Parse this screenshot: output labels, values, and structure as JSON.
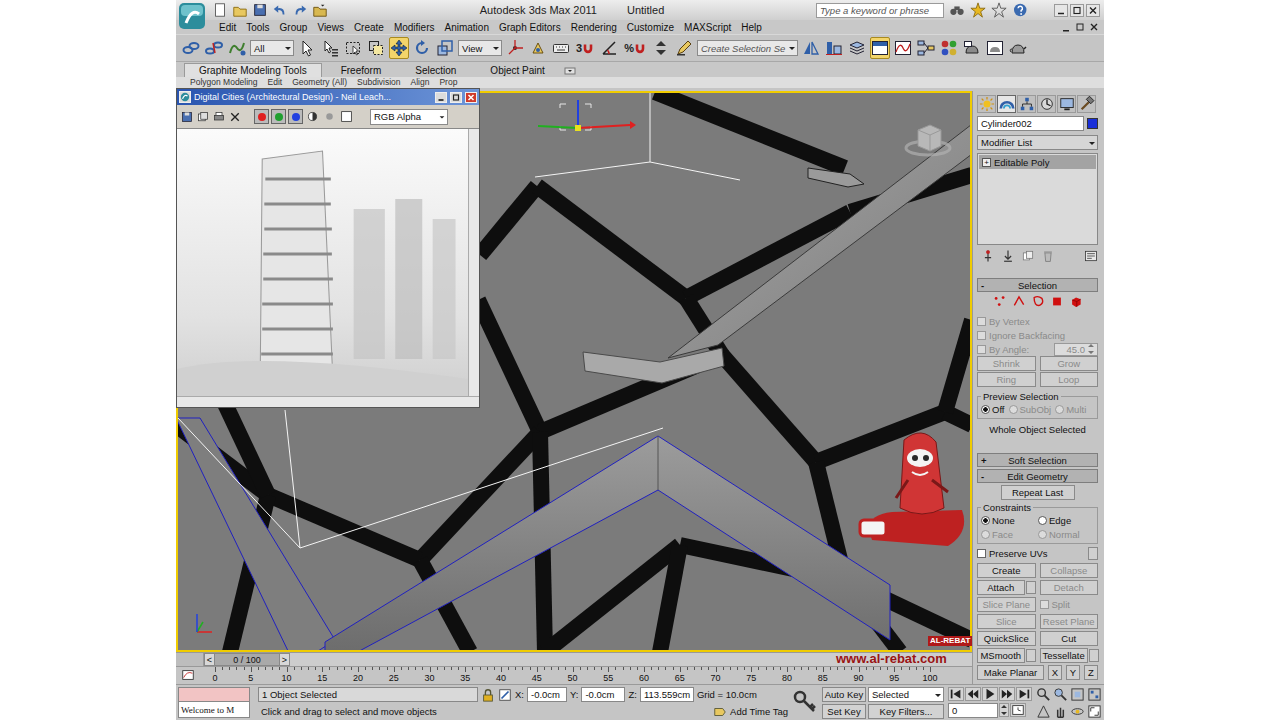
{
  "window": {
    "title": "Autodesk 3ds Max 2011",
    "document": "Untitled"
  },
  "search": {
    "placeholder": "Type a keyword or phrase"
  },
  "menu": [
    "Edit",
    "Tools",
    "Group",
    "Views",
    "Create",
    "Modifiers",
    "Animation",
    "Graph Editors",
    "Rendering",
    "Customize",
    "MAXScript",
    "Help"
  ],
  "toolbar": [
    {
      "kind": "icon",
      "selected": false
    },
    {
      "kind": "icon",
      "selected": false
    },
    {
      "kind": "icon",
      "selected": false
    },
    {
      "kind": "dropdown",
      "value": "All"
    },
    {
      "kind": "icon",
      "selected": false
    },
    {
      "kind": "icon",
      "selected": false
    },
    {
      "kind": "icon",
      "selected": false
    },
    {
      "kind": "icon",
      "selected": false
    },
    {
      "kind": "icon",
      "selected": true
    },
    {
      "kind": "icon",
      "selected": false
    },
    {
      "kind": "icon",
      "selected": false
    },
    {
      "kind": "dropdown",
      "value": "View"
    },
    {
      "kind": "icon",
      "selected": false
    },
    {
      "kind": "icon",
      "selected": false
    },
    {
      "kind": "icon",
      "selected": false
    },
    {
      "kind": "snap",
      "label": "3",
      "selected": false
    },
    {
      "kind": "icon",
      "selected": false
    },
    {
      "kind": "snap",
      "label": "%",
      "selected": false
    },
    {
      "kind": "icon",
      "selected": false
    },
    {
      "kind": "icon",
      "selected": false
    },
    {
      "kind": "dropdown",
      "value": "Create Selection Se"
    },
    {
      "kind": "icon",
      "selected": false
    },
    {
      "kind": "icon",
      "selected": false
    },
    {
      "kind": "icon",
      "selected": false
    },
    {
      "kind": "icon",
      "selected": true
    },
    {
      "kind": "icon",
      "selected": false
    },
    {
      "kind": "icon",
      "selected": false
    },
    {
      "kind": "icon",
      "selected": false
    },
    {
      "kind": "icon",
      "selected": false
    },
    {
      "kind": "icon",
      "selected": false
    },
    {
      "kind": "icon",
      "selected": false
    }
  ],
  "ribbon": {
    "tabs": [
      {
        "label": "Graphite Modeling Tools",
        "selected": true
      },
      {
        "label": "Freeform",
        "selected": false
      },
      {
        "label": "Selection",
        "selected": false
      },
      {
        "label": "Object Paint",
        "selected": false
      }
    ],
    "panels": [
      "Polygon Modeling",
      "Edit",
      "Geometry (All)",
      "Subdivision",
      "Align",
      "Prop"
    ]
  },
  "image_window": {
    "title": "Digital Cities (Architectural Design) - Neil Leach...",
    "channels": [
      {
        "color": "#e02020",
        "on": true
      },
      {
        "color": "#20a030",
        "on": true
      },
      {
        "color": "#2040e0",
        "on": true
      }
    ],
    "display": "RGB Alpha"
  },
  "command_panel": {
    "tabs": [
      {
        "selected": false
      },
      {
        "selected": true
      },
      {
        "selected": false
      },
      {
        "selected": false
      },
      {
        "selected": false
      },
      {
        "selected": false
      }
    ],
    "object_name": "Cylinder002",
    "object_color": "#1a2fd8",
    "modifier_list": "Modifier List",
    "stack": [
      {
        "label": "Editable Poly",
        "selected": true,
        "expander": "+"
      }
    ],
    "selection": {
      "sign": "-",
      "title": "Selection",
      "subobjects": [
        {
          "selected": false
        },
        {
          "selected": false
        },
        {
          "selected": false
        },
        {
          "selected": false
        },
        {
          "selected": false
        }
      ],
      "options": [
        {
          "label": "By Vertex",
          "checked": false,
          "disabled": true
        },
        {
          "label": "Ignore Backfacing",
          "checked": false,
          "disabled": true
        },
        {
          "label": "By Angle:",
          "checked": false,
          "disabled": true
        }
      ],
      "angle": "45.0",
      "buttons": [
        [
          {
            "label": "Shrink",
            "disabled": true
          },
          {
            "label": "Grow",
            "disabled": true
          }
        ],
        [
          {
            "label": "Ring",
            "disabled": true
          },
          {
            "label": "Loop",
            "disabled": true
          }
        ]
      ],
      "preview": {
        "title": "Preview Selection",
        "options": [
          {
            "label": "Off",
            "selected": true,
            "disabled": false
          },
          {
            "label": "SubObj",
            "selected": false,
            "disabled": true
          },
          {
            "label": "Multi",
            "selected": false,
            "disabled": true
          }
        ]
      },
      "status": "Whole Object Selected"
    },
    "soft_selection": {
      "sign": "+",
      "title": "Soft Selection"
    },
    "edit_geometry": {
      "sign": "-",
      "title": "Edit Geometry",
      "repeat": "Repeat Last",
      "constraints": {
        "title": "Constraints",
        "options": [
          {
            "label": "None",
            "selected": true,
            "disabled": false
          },
          {
            "label": "Edge",
            "selected": false,
            "disabled": false
          },
          {
            "label": "Face",
            "selected": false,
            "disabled": true
          },
          {
            "label": "Normal",
            "selected": false,
            "disabled": true
          }
        ]
      },
      "rows": [
        [
          {
            "kind": "checkbox",
            "label": "Preserve UVs",
            "checked": false,
            "disabled": false,
            "settings": true
          }
        ],
        [
          {
            "kind": "button",
            "label": "Create",
            "disabled": false,
            "settings": false
          },
          {
            "kind": "button",
            "label": "Collapse",
            "disabled": true,
            "settings": false
          }
        ],
        [
          {
            "kind": "button",
            "label": "Attach",
            "disabled": false,
            "settings": true
          },
          {
            "kind": "button",
            "label": "Detach",
            "disabled": true,
            "settings": false
          }
        ],
        [
          {
            "kind": "button",
            "label": "Slice Plane",
            "disabled": true,
            "settings": false
          },
          {
            "kind": "checkbox",
            "label": "Split",
            "checked": false,
            "disabled": true,
            "settings": false
          }
        ],
        [
          {
            "kind": "button",
            "label": "Slice",
            "disabled": true,
            "settings": false
          },
          {
            "kind": "button",
            "label": "Reset Plane",
            "disabled": true,
            "settings": false
          }
        ],
        [
          {
            "kind": "button",
            "label": "QuickSlice",
            "disabled": false,
            "settings": false
          },
          {
            "kind": "button",
            "label": "Cut",
            "disabled": false,
            "settings": false
          }
        ],
        [
          {
            "kind": "button",
            "label": "MSmooth",
            "disabled": false,
            "settings": true
          },
          {
            "kind": "button",
            "label": "Tessellate",
            "disabled": false,
            "settings": true
          }
        ],
        [
          {
            "kind": "button",
            "label": "Make Planar",
            "disabled": false,
            "settings": false
          },
          {
            "kind": "axis",
            "label": "X",
            "disabled": false,
            "settings": false
          },
          {
            "kind": "axis",
            "label": "Y",
            "disabled": false,
            "settings": false
          },
          {
            "kind": "axis",
            "label": "Z",
            "disabled": false,
            "settings": false
          }
        ]
      ]
    }
  },
  "timeline": {
    "slider": {
      "label": "0 / 100",
      "level": 0,
      "prev": "<",
      "next": ">"
    },
    "ticks": [
      "0",
      "5",
      "10",
      "15",
      "20",
      "25",
      "30",
      "35",
      "40",
      "45",
      "50",
      "55",
      "60",
      "65",
      "70",
      "75",
      "80",
      "85",
      "90",
      "95",
      "100"
    ]
  },
  "status_bar": {
    "listener": "Welcome to M",
    "selection": "1 Object Selected",
    "prompt": "Click and drag to select and move objects",
    "coords": [
      {
        "axis": "X:",
        "value": "-0.0cm"
      },
      {
        "axis": "Y:",
        "value": "-0.0cm"
      },
      {
        "axis": "Z:",
        "value": "113.559cm"
      }
    ],
    "grid": "Grid = 10.0cm",
    "time_tag": "Add Time Tag",
    "auto_key": {
      "label": "Auto Key",
      "on": false
    },
    "key_mode": "Selected",
    "set_key": "Set Key",
    "key_filters": "Key Filters...",
    "frame": "0"
  },
  "watermark": {
    "brand": "AL-REBAT",
    "url": "www.al-rebat.com"
  }
}
